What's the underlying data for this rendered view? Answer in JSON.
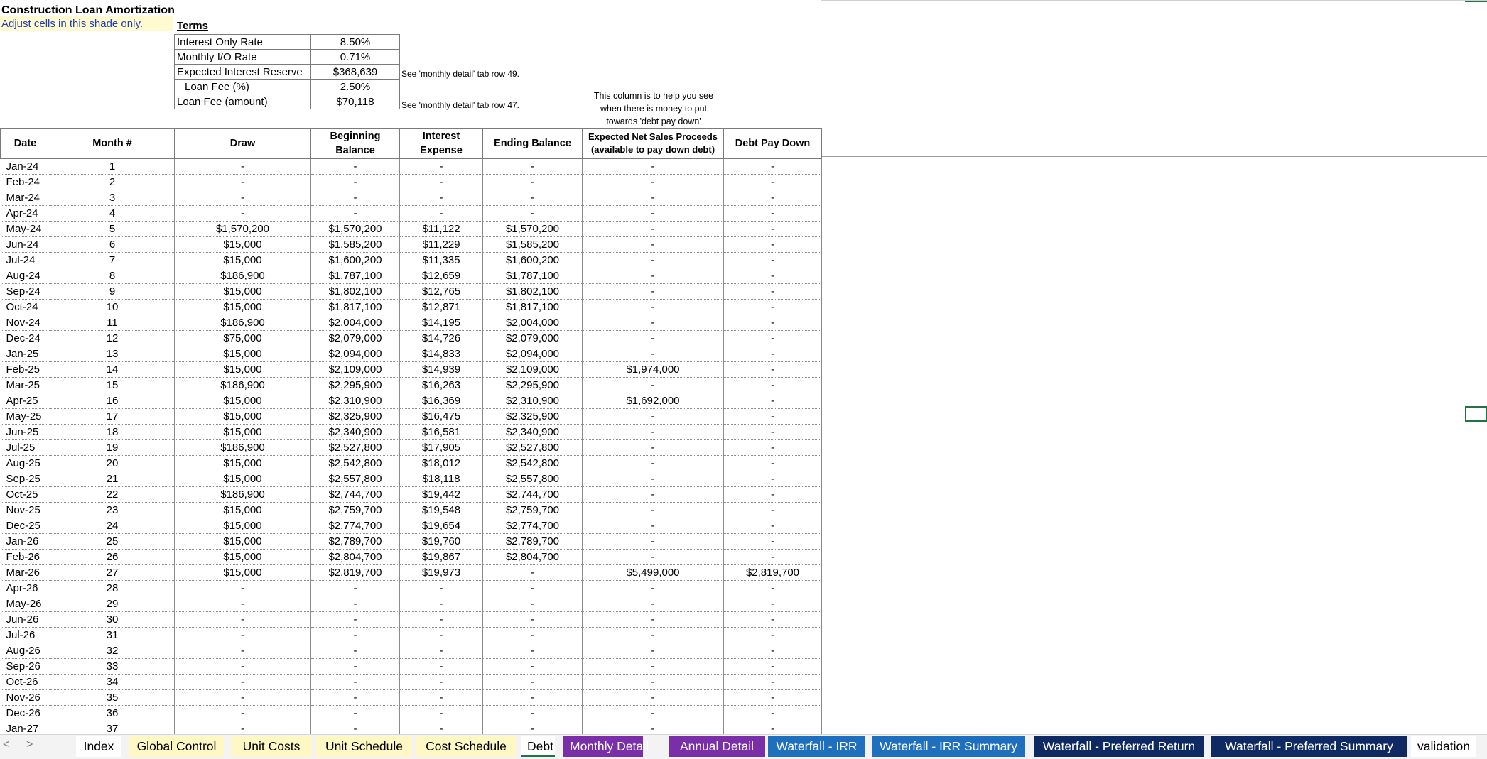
{
  "sheet": {
    "title": "Construction Loan Amortization",
    "instruction": "Adjust cells in this shade only.",
    "terms_heading": "Terms"
  },
  "terms": [
    {
      "label": "Interest Only Rate",
      "value": "8.50%",
      "note": ""
    },
    {
      "label": "Monthly I/O Rate",
      "value": "0.71%",
      "note": ""
    },
    {
      "label": "Expected Interest Reserve",
      "value": "$368,639",
      "note": "See 'monthly detail' tab row 49."
    },
    {
      "label": "Loan Fee (%)",
      "value": "2.50%",
      "note": ""
    },
    {
      "label": "Loan Fee (amount)",
      "value": "$70,118",
      "note": "See 'monthly detail' tab row 47."
    }
  ],
  "column_note": [
    "This column is to help you see",
    "when there is money to put",
    "towards 'debt pay down'"
  ],
  "headers": {
    "date": "Date",
    "month": "Month #",
    "draw": "Draw",
    "beginning_balance": "Beginning Balance",
    "interest_expense": "Interest Expense",
    "ending_balance": "Ending Balance",
    "net_sales": "Expected Net Sales Proceeds (available to pay down debt)",
    "debt_pay_down": "Debt Pay Down"
  },
  "rows": [
    [
      "Jan-24",
      "1",
      "-",
      "-",
      "-",
      "-",
      "-",
      "-"
    ],
    [
      "Feb-24",
      "2",
      "-",
      "-",
      "-",
      "-",
      "-",
      "-"
    ],
    [
      "Mar-24",
      "3",
      "-",
      "-",
      "-",
      "-",
      "-",
      "-"
    ],
    [
      "Apr-24",
      "4",
      "-",
      "-",
      "-",
      "-",
      "-",
      "-"
    ],
    [
      "May-24",
      "5",
      "$1,570,200",
      "$1,570,200",
      "$11,122",
      "$1,570,200",
      "-",
      "-"
    ],
    [
      "Jun-24",
      "6",
      "$15,000",
      "$1,585,200",
      "$11,229",
      "$1,585,200",
      "-",
      "-"
    ],
    [
      "Jul-24",
      "7",
      "$15,000",
      "$1,600,200",
      "$11,335",
      "$1,600,200",
      "-",
      "-"
    ],
    [
      "Aug-24",
      "8",
      "$186,900",
      "$1,787,100",
      "$12,659",
      "$1,787,100",
      "-",
      "-"
    ],
    [
      "Sep-24",
      "9",
      "$15,000",
      "$1,802,100",
      "$12,765",
      "$1,802,100",
      "-",
      "-"
    ],
    [
      "Oct-24",
      "10",
      "$15,000",
      "$1,817,100",
      "$12,871",
      "$1,817,100",
      "-",
      "-"
    ],
    [
      "Nov-24",
      "11",
      "$186,900",
      "$2,004,000",
      "$14,195",
      "$2,004,000",
      "-",
      "-"
    ],
    [
      "Dec-24",
      "12",
      "$75,000",
      "$2,079,000",
      "$14,726",
      "$2,079,000",
      "-",
      "-"
    ],
    [
      "Jan-25",
      "13",
      "$15,000",
      "$2,094,000",
      "$14,833",
      "$2,094,000",
      "-",
      "-"
    ],
    [
      "Feb-25",
      "14",
      "$15,000",
      "$2,109,000",
      "$14,939",
      "$2,109,000",
      "$1,974,000",
      "-"
    ],
    [
      "Mar-25",
      "15",
      "$186,900",
      "$2,295,900",
      "$16,263",
      "$2,295,900",
      "-",
      "-"
    ],
    [
      "Apr-25",
      "16",
      "$15,000",
      "$2,310,900",
      "$16,369",
      "$2,310,900",
      "$1,692,000",
      "-"
    ],
    [
      "May-25",
      "17",
      "$15,000",
      "$2,325,900",
      "$16,475",
      "$2,325,900",
      "-",
      "-"
    ],
    [
      "Jun-25",
      "18",
      "$15,000",
      "$2,340,900",
      "$16,581",
      "$2,340,900",
      "-",
      "-"
    ],
    [
      "Jul-25",
      "19",
      "$186,900",
      "$2,527,800",
      "$17,905",
      "$2,527,800",
      "-",
      "-"
    ],
    [
      "Aug-25",
      "20",
      "$15,000",
      "$2,542,800",
      "$18,012",
      "$2,542,800",
      "-",
      "-"
    ],
    [
      "Sep-25",
      "21",
      "$15,000",
      "$2,557,800",
      "$18,118",
      "$2,557,800",
      "-",
      "-"
    ],
    [
      "Oct-25",
      "22",
      "$186,900",
      "$2,744,700",
      "$19,442",
      "$2,744,700",
      "-",
      "-"
    ],
    [
      "Nov-25",
      "23",
      "$15,000",
      "$2,759,700",
      "$19,548",
      "$2,759,700",
      "-",
      "-"
    ],
    [
      "Dec-25",
      "24",
      "$15,000",
      "$2,774,700",
      "$19,654",
      "$2,774,700",
      "-",
      "-"
    ],
    [
      "Jan-26",
      "25",
      "$15,000",
      "$2,789,700",
      "$19,760",
      "$2,789,700",
      "-",
      "-"
    ],
    [
      "Feb-26",
      "26",
      "$15,000",
      "$2,804,700",
      "$19,867",
      "$2,804,700",
      "-",
      "-"
    ],
    [
      "Mar-26",
      "27",
      "$15,000",
      "$2,819,700",
      "$19,973",
      "-",
      "$5,499,000",
      "$2,819,700"
    ],
    [
      "Apr-26",
      "28",
      "-",
      "-",
      "-",
      "-",
      "-",
      "-"
    ],
    [
      "May-26",
      "29",
      "-",
      "-",
      "-",
      "-",
      "-",
      "-"
    ],
    [
      "Jun-26",
      "30",
      "-",
      "-",
      "-",
      "-",
      "-",
      "-"
    ],
    [
      "Jul-26",
      "31",
      "-",
      "-",
      "-",
      "-",
      "-",
      "-"
    ],
    [
      "Aug-26",
      "32",
      "-",
      "-",
      "-",
      "-",
      "-",
      "-"
    ],
    [
      "Sep-26",
      "33",
      "-",
      "-",
      "-",
      "-",
      "-",
      "-"
    ],
    [
      "Oct-26",
      "34",
      "-",
      "-",
      "-",
      "-",
      "-",
      "-"
    ],
    [
      "Nov-26",
      "35",
      "-",
      "-",
      "-",
      "-",
      "-",
      "-"
    ],
    [
      "Dec-26",
      "36",
      "-",
      "-",
      "-",
      "-",
      "-",
      "-"
    ],
    [
      "Jan-27",
      "37",
      "-",
      "-",
      "-",
      "-",
      "-",
      "-"
    ]
  ],
  "tabs": [
    {
      "label": "Index",
      "style": "plain"
    },
    {
      "label": "Global Control",
      "style": "yellow"
    },
    {
      "label": "Unit Costs",
      "style": "yellow"
    },
    {
      "label": "Unit Schedule",
      "style": "yellow"
    },
    {
      "label": "Cost Schedule",
      "style": "yellow"
    },
    {
      "label": "Debt",
      "style": "active"
    },
    {
      "label": "Monthly Detail",
      "style": "purple"
    },
    {
      "label": "Annual Detail",
      "style": "purple"
    },
    {
      "label": "Waterfall - IRR",
      "style": "blue"
    },
    {
      "label": "Waterfall - IRR Summary",
      "style": "blue"
    },
    {
      "label": "Waterfall - Preferred Return",
      "style": "navy"
    },
    {
      "label": "Waterfall - Preferred Summary",
      "style": "navy"
    },
    {
      "label": "validation",
      "style": "plain"
    }
  ],
  "nav": {
    "prev": "<",
    "next": ">"
  },
  "colors": {
    "instruction_shade": "#fffad0",
    "instruction_text": "#1f3fb0",
    "purple_tab": "#7a2fa8",
    "blue_tab": "#1f6fbf",
    "navy_tab": "#0f2a63",
    "selection": "#217346"
  }
}
